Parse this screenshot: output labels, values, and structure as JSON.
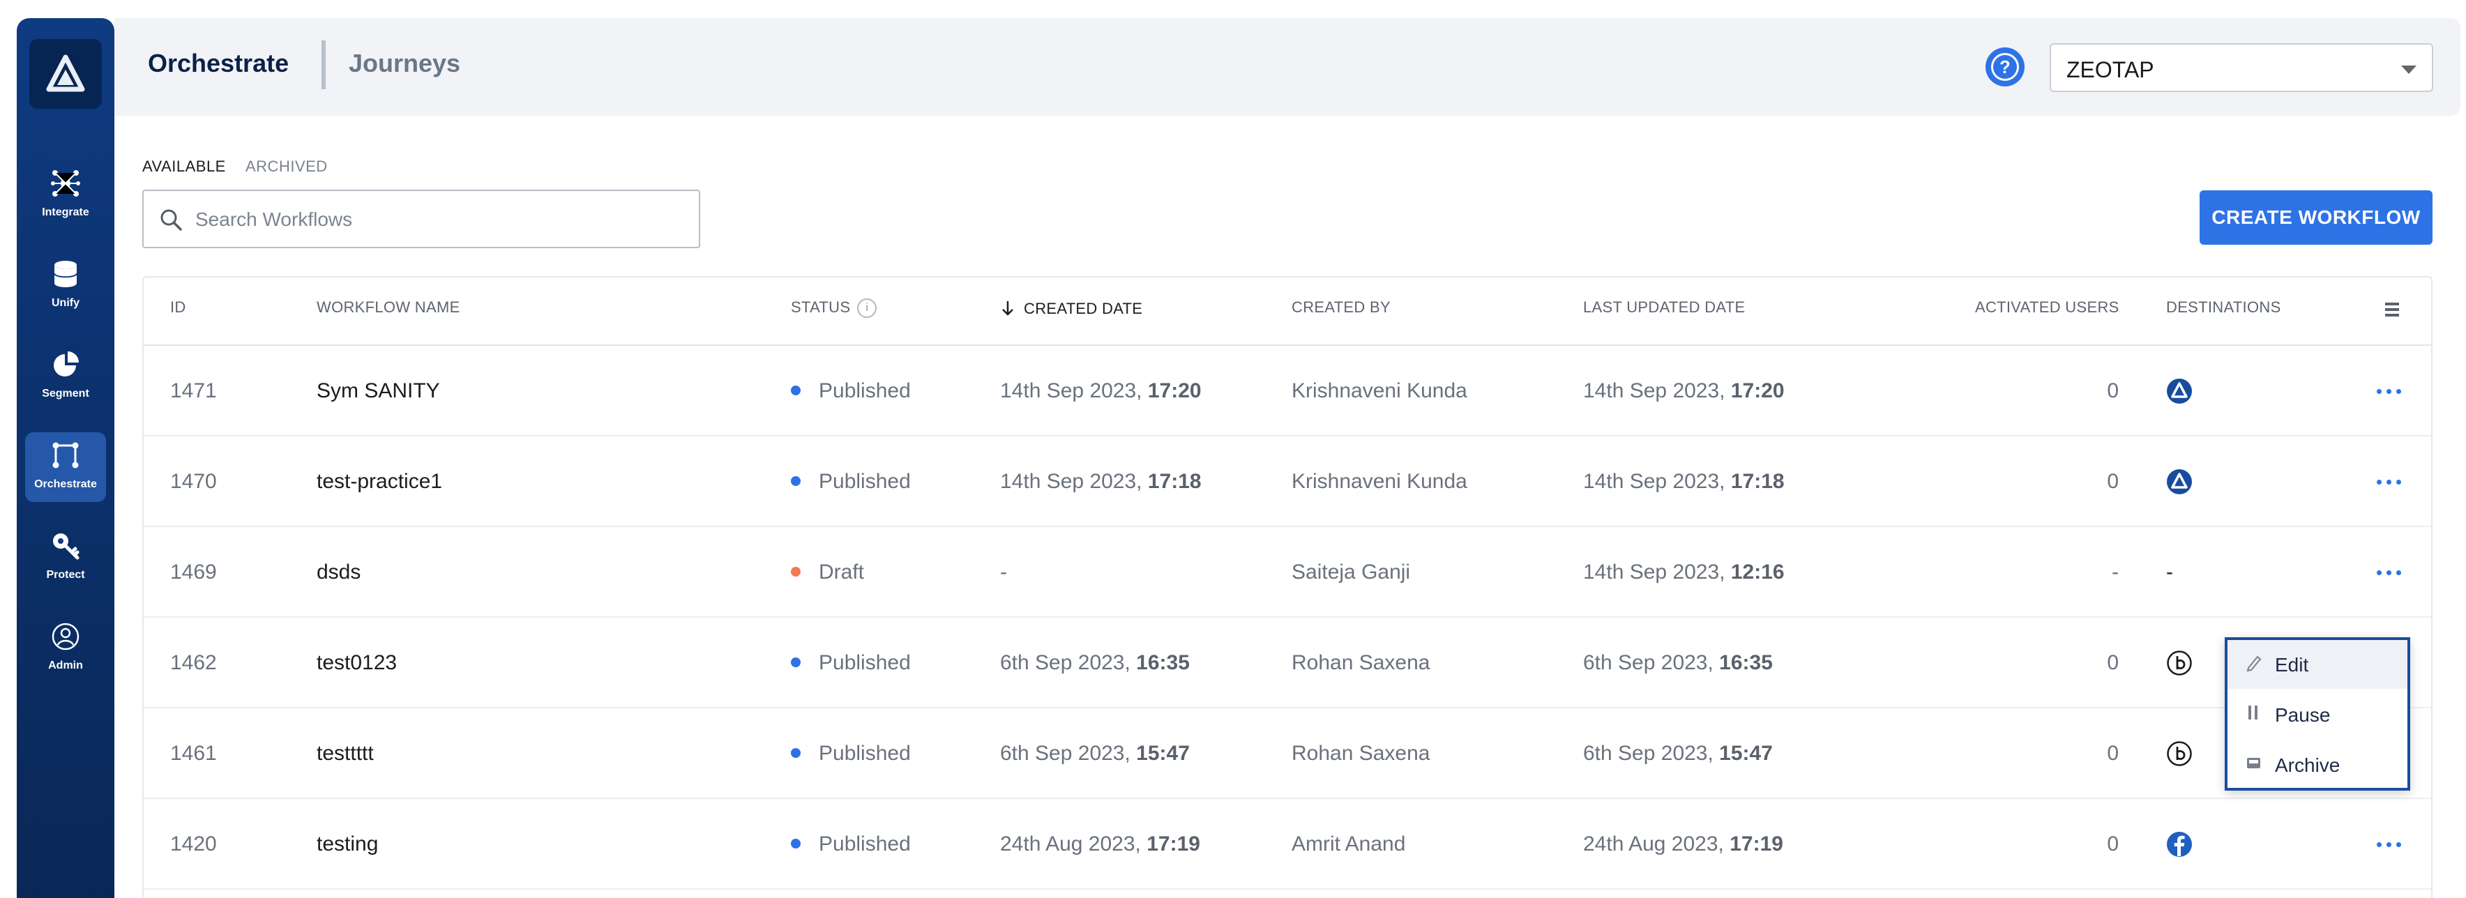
{
  "sidebar": {
    "items": [
      {
        "label": "Integrate",
        "icon": "integrate-icon"
      },
      {
        "label": "Unify",
        "icon": "database-icon"
      },
      {
        "label": "Segment",
        "icon": "pie-chart-icon"
      },
      {
        "label": "Orchestrate",
        "icon": "orchestrate-icon",
        "active": true
      },
      {
        "label": "Protect",
        "icon": "key-icon"
      },
      {
        "label": "Admin",
        "icon": "user-icon"
      }
    ]
  },
  "header": {
    "title": "Orchestrate",
    "subtitle": "Journeys",
    "help_icon": "?",
    "account_select": "ZEOTAP"
  },
  "tabs": {
    "available": "AVAILABLE",
    "archived": "ARCHIVED"
  },
  "search": {
    "placeholder": "Search Workflows"
  },
  "create_button": "CREATE WORKFLOW",
  "table": {
    "columns": {
      "id": "ID",
      "name": "WORKFLOW NAME",
      "status": "STATUS",
      "created_date": "CREATED DATE",
      "created_by": "CREATED BY",
      "last_updated": "LAST UPDATED DATE",
      "activated_users": "ACTIVATED USERS",
      "destinations": "DESTINATIONS"
    },
    "sort": {
      "column": "created_date",
      "direction": "descending"
    },
    "rows": [
      {
        "id": "1471",
        "name": "Sym SANITY",
        "status": "Published",
        "status_color": "#2f72e5",
        "created_day": "14th Sep 2023,",
        "created_time": "17:20",
        "created_by": "Krishnaveni Kunda",
        "updated_day": "14th Sep 2023,",
        "updated_time": "17:20",
        "users": "0",
        "destination_icon": "zeotap-icon"
      },
      {
        "id": "1470",
        "name": "test-practice1",
        "status": "Published",
        "status_color": "#2f72e5",
        "created_day": "14th Sep 2023,",
        "created_time": "17:18",
        "created_by": "Krishnaveni Kunda",
        "updated_day": "14th Sep 2023,",
        "updated_time": "17:18",
        "users": "0",
        "destination_icon": "zeotap-icon"
      },
      {
        "id": "1469",
        "name": "dsds",
        "status": "Draft",
        "status_color": "#f07a4f",
        "created_day": "-",
        "created_time": "",
        "created_by": "Saiteja Ganji",
        "updated_day": "14th Sep 2023,",
        "updated_time": "12:16",
        "users": "-",
        "destination_text": "-"
      },
      {
        "id": "1462",
        "name": "test0123",
        "status": "Published",
        "status_color": "#2f72e5",
        "created_day": "6th Sep 2023,",
        "created_time": "16:35",
        "created_by": "Rohan Saxena",
        "updated_day": "6th Sep 2023,",
        "updated_time": "16:35",
        "users": "0",
        "destination_icon": "b-circle-icon"
      },
      {
        "id": "1461",
        "name": "testtttt",
        "status": "Published",
        "status_color": "#2f72e5",
        "created_day": "6th Sep 2023,",
        "created_time": "15:47",
        "created_by": "Rohan Saxena",
        "updated_day": "6th Sep 2023,",
        "updated_time": "15:47",
        "users": "0",
        "destination_icon": "b-circle-icon"
      },
      {
        "id": "1420",
        "name": "testing",
        "status": "Published",
        "status_color": "#2f72e5",
        "created_day": "24th Aug 2023,",
        "created_time": "17:19",
        "created_by": "Amrit Anand",
        "updated_day": "24th Aug 2023,",
        "updated_time": "17:19",
        "users": "0",
        "destination_icon": "facebook-icon"
      }
    ]
  },
  "context_menu": {
    "items": [
      {
        "label": "Edit",
        "icon": "pencil-icon"
      },
      {
        "label": "Pause",
        "icon": "pause-icon"
      },
      {
        "label": "Archive",
        "icon": "archive-icon"
      }
    ]
  },
  "colors": {
    "primary": "#2e73e6",
    "sidebar": "#0f3b82",
    "published": "#2f72e5",
    "draft": "#f07a4f"
  }
}
